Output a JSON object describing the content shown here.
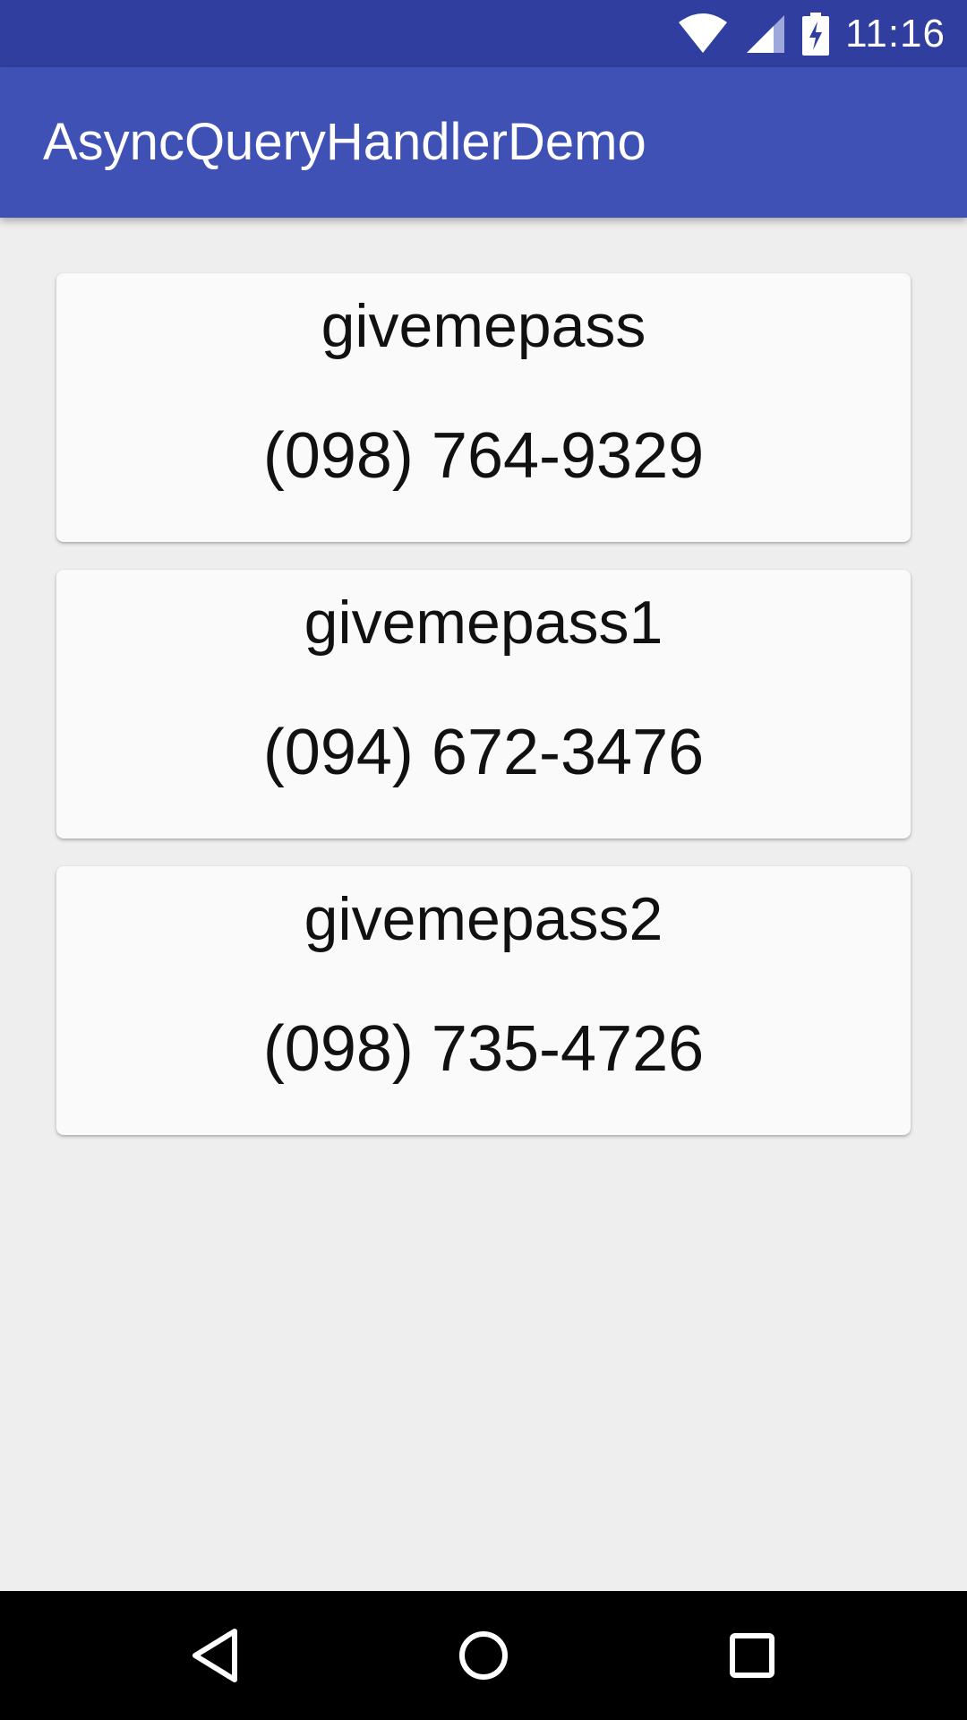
{
  "status_bar": {
    "time": "11:16",
    "icons": [
      "wifi-icon",
      "cell-signal-icon",
      "battery-charging-icon"
    ]
  },
  "app_bar": {
    "title": "AsyncQueryHandlerDemo"
  },
  "contacts": [
    {
      "name": "givemepass",
      "phone": "(098) 764-9329"
    },
    {
      "name": "givemepass1",
      "phone": "(094) 672-3476"
    },
    {
      "name": "givemepass2",
      "phone": "(098) 735-4726"
    }
  ],
  "nav_bar": {
    "buttons": [
      "back-icon",
      "home-icon",
      "recents-icon"
    ]
  },
  "colors": {
    "status_bar": "#303f9f",
    "app_bar": "#3f51b5",
    "background": "#eeeeee",
    "card": "#fafafa",
    "nav_bar": "#000000"
  }
}
